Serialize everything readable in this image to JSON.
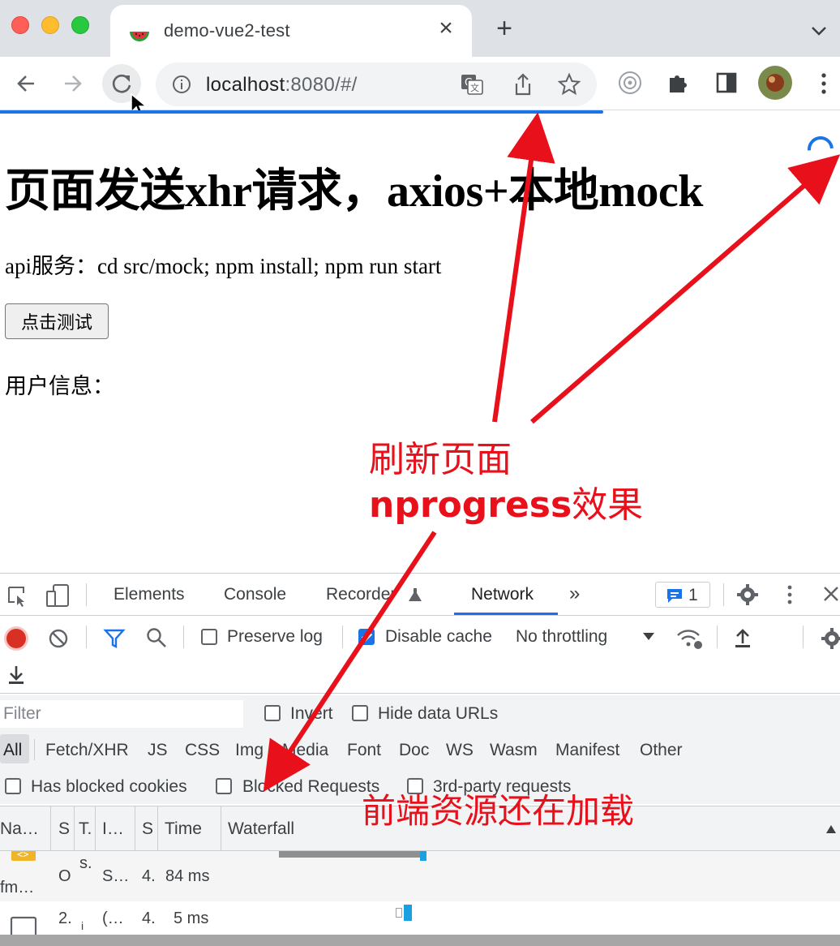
{
  "browser": {
    "tab_title": "demo-vue2-test",
    "url_host": "localhost",
    "url_rest": ":8080/#/"
  },
  "page": {
    "heading": "页面发送xhr请求，axios+本地mock",
    "api_text": "api服务：cd src/mock; npm install; npm run start",
    "test_button": "点击测试",
    "user_info_label": "用户信息："
  },
  "annotations": {
    "refresh_line1": "刷新页面",
    "refresh_line2_bold": "nprogress",
    "refresh_line2_rest": "效果",
    "loading_note": "前端资源还在加载"
  },
  "devtools": {
    "tabs": [
      "Elements",
      "Console",
      "Recorder",
      "Network"
    ],
    "more_tabs": "»",
    "issues_count": "1",
    "toolbar": {
      "preserve_log": "Preserve log",
      "disable_cache": "Disable cache",
      "throttling": "No throttling"
    },
    "filter": {
      "placeholder": "Filter",
      "invert": "Invert",
      "hide_data_urls": "Hide data URLs",
      "types": [
        "All",
        "Fetch/XHR",
        "JS",
        "CSS",
        "Img",
        "Media",
        "Font",
        "Doc",
        "WS",
        "Wasm",
        "Manifest",
        "Other"
      ],
      "has_blocked_cookies": "Has blocked cookies",
      "blocked_requests": "Blocked Requests",
      "third_party": "3rd-party requests"
    },
    "columns": [
      "Na…",
      "S",
      "T.",
      "I…",
      "S",
      "Time",
      "Waterfall"
    ],
    "rows": [
      {
        "name": "fm…",
        "status": "O",
        "type": "s.",
        "initiator": "S…",
        "size": "4.",
        "time": "84 ms"
      },
      {
        "name": "",
        "status": "2.",
        "type": "i",
        "initiator": "(…",
        "size": "4.",
        "time": "5 ms"
      }
    ],
    "colors": {
      "accent": "#1a73e8",
      "annotation": "#e8101a"
    }
  }
}
